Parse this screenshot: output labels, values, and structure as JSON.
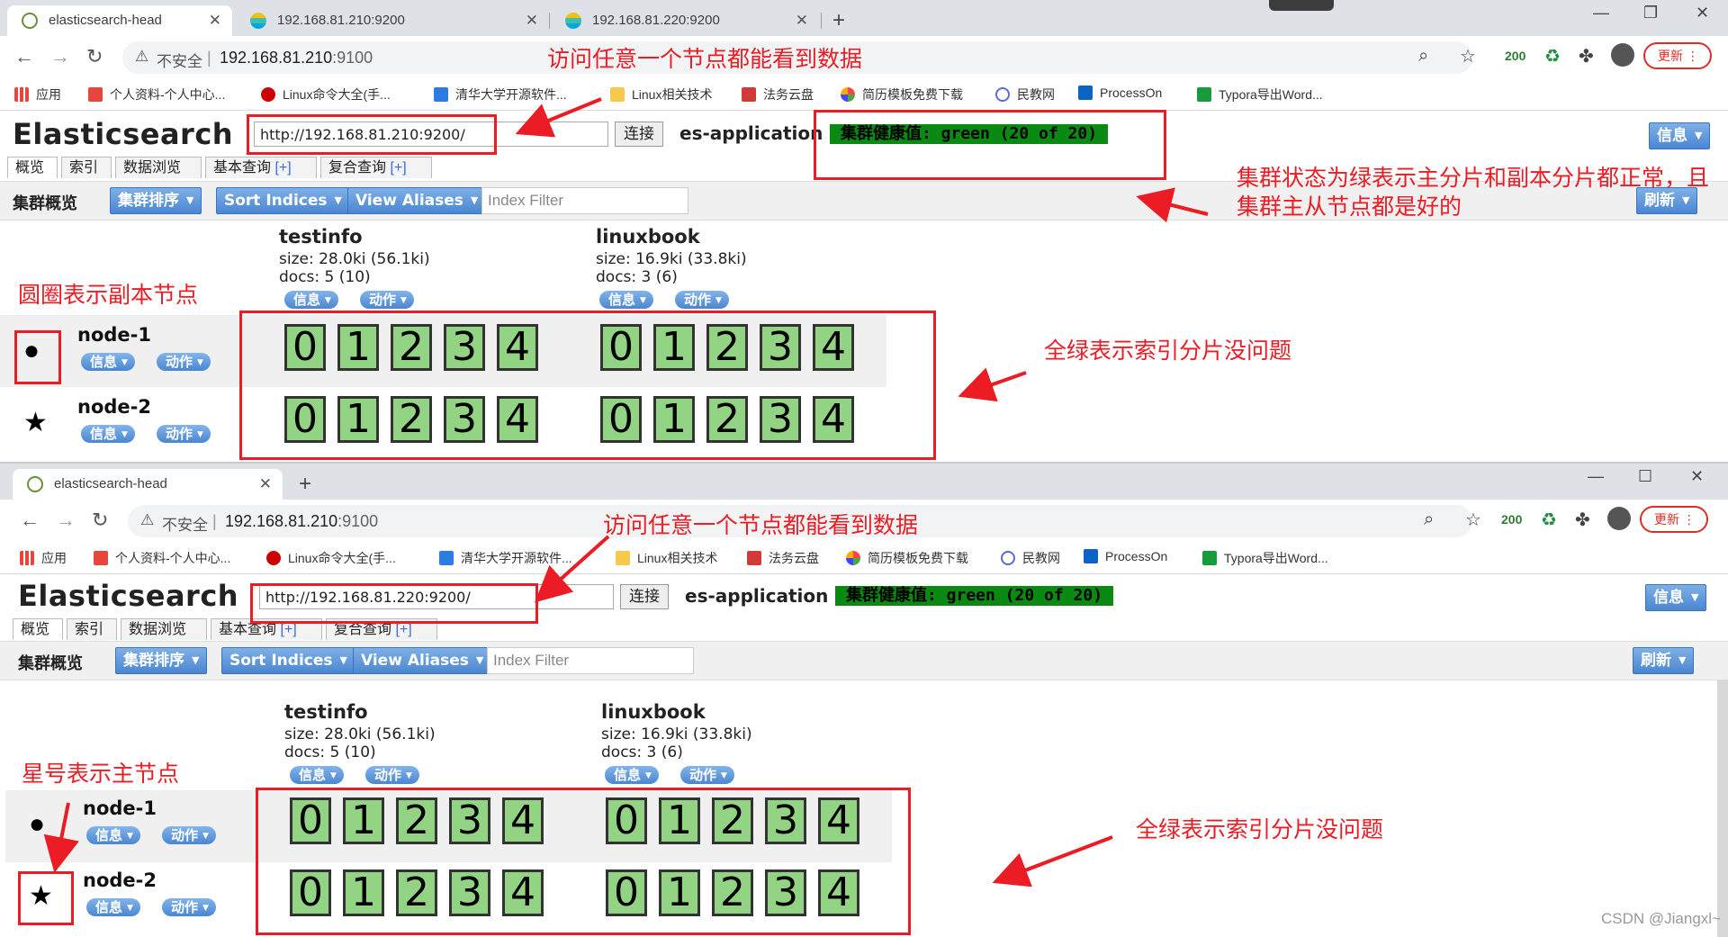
{
  "browser": {
    "tabs": [
      {
        "title": "elasticsearch-head"
      },
      {
        "title": "192.168.81.210:9200"
      },
      {
        "title": "192.168.81.220:9200"
      }
    ],
    "insecure_label": "不安全",
    "address_host": "192.168.81.210",
    "address_port": ":9100",
    "badge_200": "200",
    "update_label": "更新",
    "bookmarks": [
      {
        "label": "应用"
      },
      {
        "label": "个人资料-个人中心..."
      },
      {
        "label": "Linux命令大全(手..."
      },
      {
        "label": "清华大学开源软件..."
      },
      {
        "label": "Linux相关技术"
      },
      {
        "label": "法务云盘"
      },
      {
        "label": "简历模板免费下载"
      },
      {
        "label": "民教网"
      },
      {
        "label": "ProcessOn"
      },
      {
        "label": "Typora导出Word..."
      }
    ]
  },
  "es_top": {
    "title": "Elasticsearch",
    "url": "http://192.168.81.210:9200/",
    "connect": "连接",
    "cluster": "es-application",
    "health": "集群健康值: green (20 of 20)",
    "info_button": "信息",
    "refresh_button": "刷新",
    "tabs": [
      {
        "label": "概览",
        "plus": ""
      },
      {
        "label": "索引",
        "plus": ""
      },
      {
        "label": "数据浏览",
        "plus": ""
      },
      {
        "label": "基本查询",
        "plus": "[+]"
      },
      {
        "label": "复合查询",
        "plus": "[+]"
      }
    ],
    "toolbar_title": "集群概览",
    "sort_cluster": "集群排序",
    "sort_indices": "Sort Indices",
    "view_aliases": "View Aliases",
    "filter_placeholder": "Index Filter"
  },
  "es_bottom": {
    "url": "http://192.168.81.220:9200/"
  },
  "indices": [
    {
      "name": "testinfo",
      "size": "size: 28.0ki (56.1ki)",
      "docs": "docs: 5 (10)"
    },
    {
      "name": "linuxbook",
      "size": "size: 16.9ki (33.8ki)",
      "docs": "docs: 3 (6)"
    }
  ],
  "actions": {
    "info": "信息",
    "action": "动作"
  },
  "nodes": [
    {
      "name": "node-1",
      "icon": "circle-icon"
    },
    {
      "name": "node-2",
      "icon": "star-icon"
    }
  ],
  "shards": [
    "0",
    "1",
    "2",
    "3",
    "4"
  ],
  "annotations": {
    "access_any": "访问任意一个节点都能看到数据",
    "cluster_green_line1": "集群状态为绿表示主分片和副本分片都正常，且",
    "cluster_green_line2": "集群主从节点都是好的",
    "circle_replica": "圆圈表示副本节点",
    "all_green": "全绿表示索引分片没问题",
    "star_master": "星号表示主节点"
  },
  "watermark": "CSDN @Jiangxl~",
  "colors": {
    "annotation": "#ec1c24",
    "health_green": "#0a8a12",
    "shard_green": "#93d484",
    "es_button_blue": "#4a86d2"
  }
}
